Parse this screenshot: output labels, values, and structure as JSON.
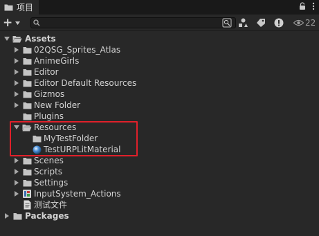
{
  "tab": {
    "label": "项目"
  },
  "toolbar": {
    "search": {
      "value": "",
      "placeholder": ""
    },
    "hidden_count": "22"
  },
  "tree": {
    "assets_label": "Assets",
    "items": [
      {
        "label": "02QSG_Sprites_Atlas"
      },
      {
        "label": "AnimeGirls"
      },
      {
        "label": "Editor"
      },
      {
        "label": "Editor Default Resources"
      },
      {
        "label": "Gizmos"
      },
      {
        "label": "New Folder"
      },
      {
        "label": "Plugins"
      },
      {
        "label": "Resources"
      },
      {
        "label": "MyTestFolder"
      },
      {
        "label": "TestURPLitMaterial"
      },
      {
        "label": "Scenes"
      },
      {
        "label": "Scripts"
      },
      {
        "label": "Settings"
      },
      {
        "label": "InputSystem_Actions"
      },
      {
        "label": "测试文件"
      }
    ],
    "packages_label": "Packages"
  },
  "colors": {
    "panel": "#282828",
    "highlight_border": "#e0202a",
    "folder": "#c4c4c4",
    "material": "#4a90d9"
  },
  "icons": {
    "tab": "folder-icon",
    "lock": "lock-icon",
    "menu": "kebab-menu-icon",
    "add": "plus-icon",
    "search": "search-icon",
    "search_by_type": "search-by-type-icon",
    "filter_type": "filter-by-type-icon",
    "filter_label": "filter-by-label-icon",
    "error": "error-icon",
    "visibility": "eye-icon"
  }
}
